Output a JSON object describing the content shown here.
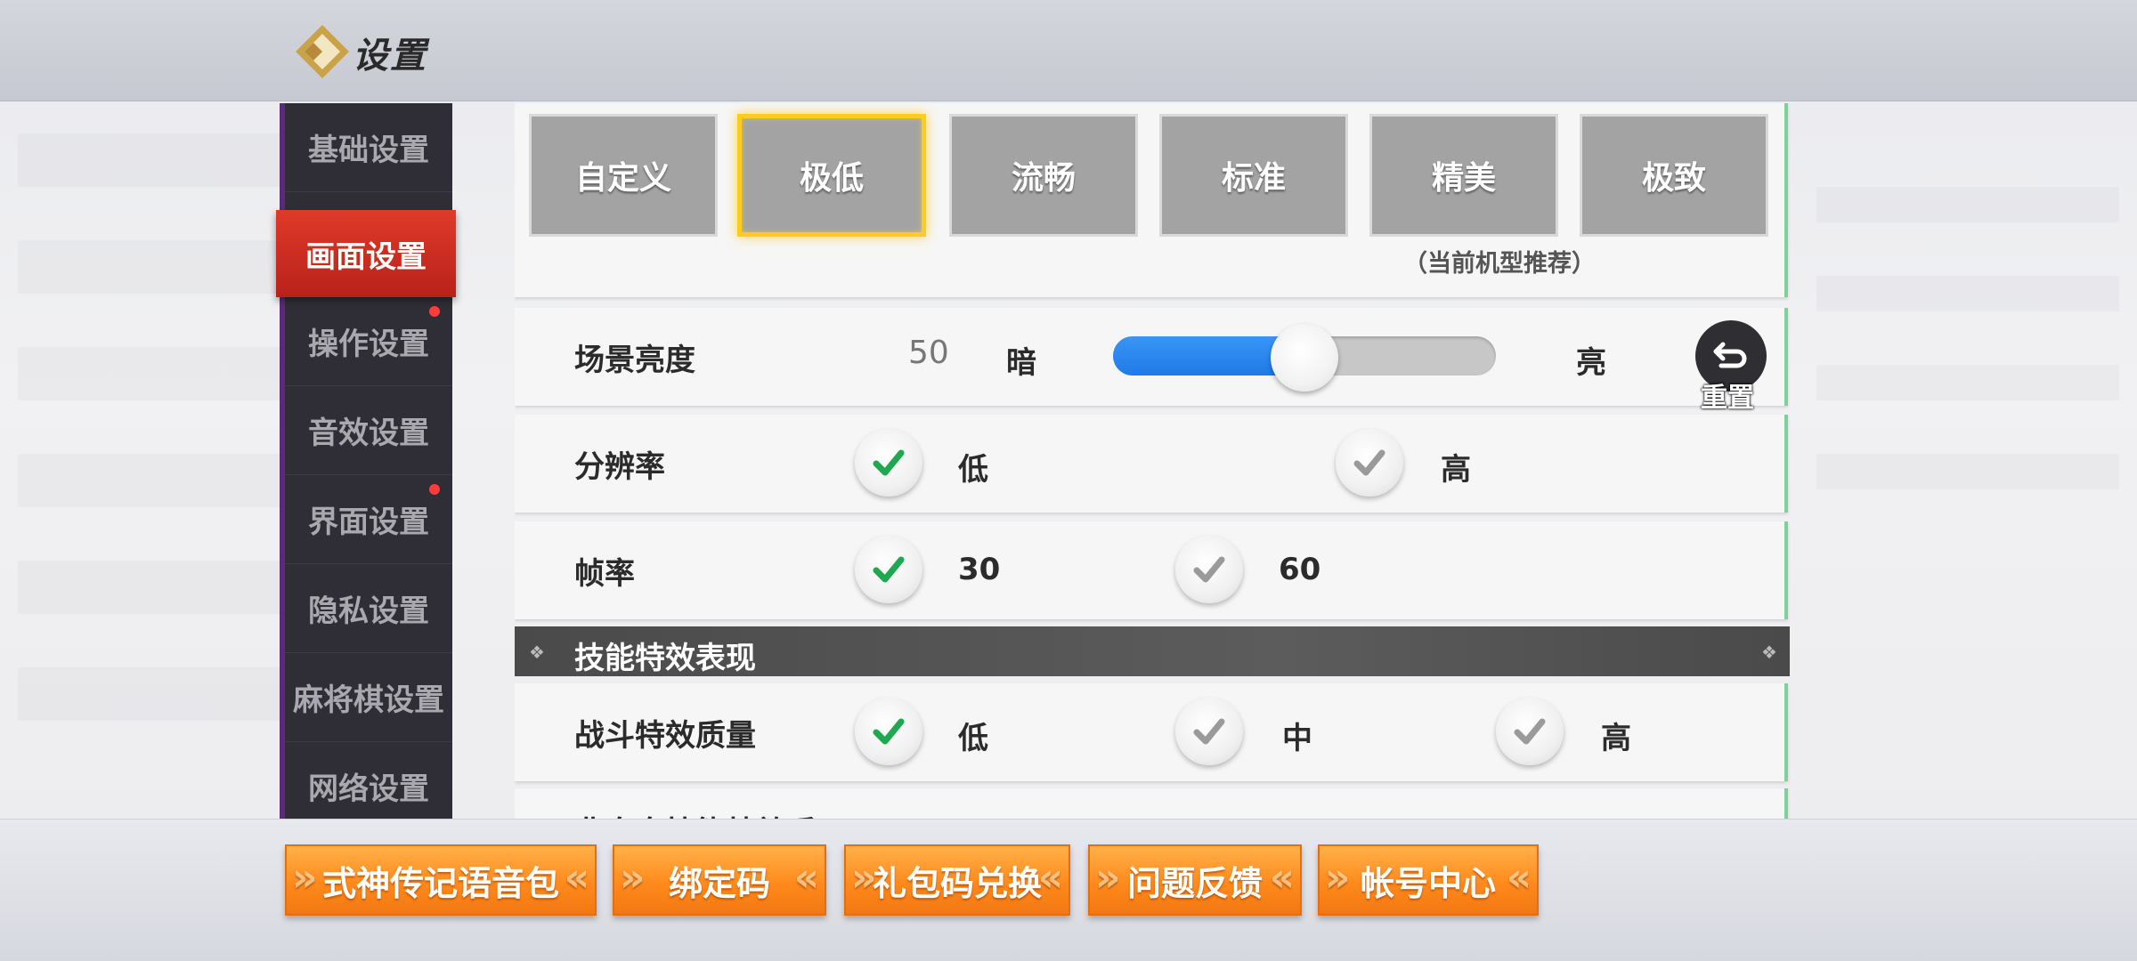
{
  "header": {
    "title": "设置"
  },
  "sidebar": {
    "items": [
      {
        "label": "基础设置",
        "active": false,
        "badge": false
      },
      {
        "label": "画面设置",
        "active": true,
        "badge": false
      },
      {
        "label": "操作设置",
        "active": false,
        "badge": true
      },
      {
        "label": "音效设置",
        "active": false,
        "badge": false
      },
      {
        "label": "界面设置",
        "active": false,
        "badge": true
      },
      {
        "label": "隐私设置",
        "active": false,
        "badge": false
      },
      {
        "label": "麻将棋设置",
        "active": false,
        "badge": false
      },
      {
        "label": "网络设置",
        "active": false,
        "badge": false
      }
    ]
  },
  "presets": {
    "items": [
      "自定义",
      "极低",
      "流畅",
      "标准",
      "精美",
      "极致"
    ],
    "selected": "极低",
    "recommended_note": "（当前机型推荐）"
  },
  "brightness": {
    "label": "场景亮度",
    "value": "50",
    "value_fraction": 0.5,
    "dark_label": "暗",
    "bright_label": "亮",
    "reset_label": "重置"
  },
  "resolution": {
    "label": "分辨率",
    "options": [
      {
        "label": "低",
        "checked": true
      },
      {
        "label": "高",
        "checked": false
      }
    ]
  },
  "framerate": {
    "label": "帧率",
    "options": [
      {
        "label": "30",
        "checked": true
      },
      {
        "label": "60",
        "checked": false
      }
    ]
  },
  "skill_section": {
    "title": "技能特效表现"
  },
  "battle_effects": {
    "label": "战斗特效质量",
    "options": [
      {
        "label": "低",
        "checked": true
      },
      {
        "label": "中",
        "checked": false
      },
      {
        "label": "高",
        "checked": false
      }
    ]
  },
  "partial_row": {
    "label": "非自身技能特效质"
  },
  "bottom_buttons": [
    "式神传记语音包",
    "绑定码",
    "礼包码兑换",
    "问题反馈",
    "帐号中心"
  ],
  "colors": {
    "accent_red": "#d42e22",
    "check_green": "#1fa84f",
    "check_gray": "#9a9a9a",
    "slider_blue": "#2a86f0",
    "preset_selected_border": "#ffcc1e",
    "orange_button": "#ff8a1c"
  }
}
